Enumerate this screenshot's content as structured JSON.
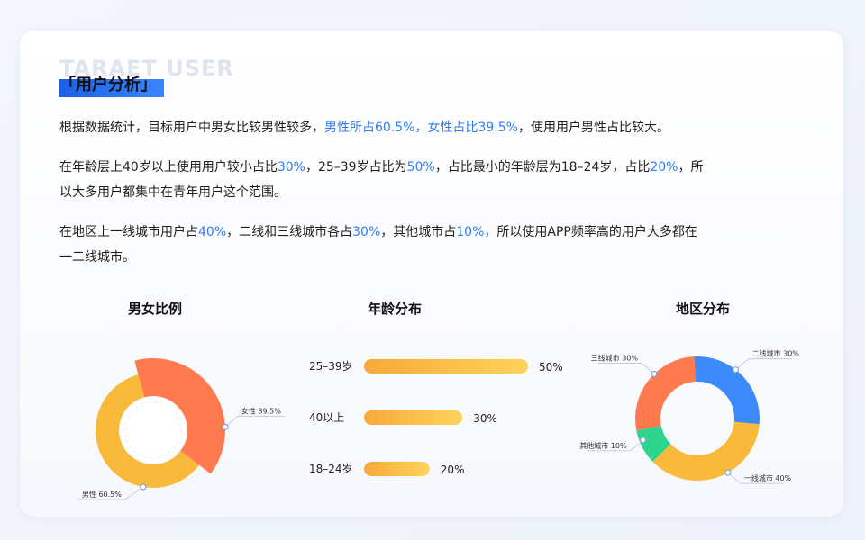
{
  "header": {
    "bg_text": "TARAET USER",
    "title": "「用户分析」"
  },
  "paragraphs": [
    [
      {
        "t": "根据数据统计，目标用户中男女比较男性较多，",
        "hl": false
      },
      {
        "t": "男性所占60.5%，女性占比39.5%",
        "hl": true
      },
      {
        "t": "，使用用户男性占比较大。",
        "hl": false
      }
    ],
    [
      {
        "t": "在年龄层上40岁以上使用用户较小占比",
        "hl": false
      },
      {
        "t": "30%",
        "hl": true
      },
      {
        "t": "，25–39岁占比为",
        "hl": false
      },
      {
        "t": "50%",
        "hl": true
      },
      {
        "t": "，占比最小的年龄层为18–24岁，占比",
        "hl": false
      },
      {
        "t": "20%",
        "hl": true
      },
      {
        "t": "，所以大多用户都集中在青年用户这个范围。",
        "hl": false
      }
    ],
    [
      {
        "t": "在地区上一线城市用户占",
        "hl": false
      },
      {
        "t": "40%",
        "hl": true
      },
      {
        "t": "，二线和三线城市各占",
        "hl": false
      },
      {
        "t": "30%",
        "hl": true
      },
      {
        "t": "，其他城市占",
        "hl": false
      },
      {
        "t": "10%，",
        "hl": true
      },
      {
        "t": "所以使用APP频率高的用户大多都在一二线城市。",
        "hl": false
      }
    ]
  ],
  "chart_data": [
    {
      "type": "pie",
      "title": "男女比例",
      "slices": [
        {
          "name": "男性",
          "value": 60.5,
          "label": "男性  60.5%",
          "color": "#f9b93a"
        },
        {
          "name": "女性",
          "value": 39.5,
          "label": "女性  39.5%",
          "color": "#ff7b4f"
        }
      ]
    },
    {
      "type": "bar",
      "title": "年龄分布",
      "orientation": "horizontal",
      "categories": [
        "25–39岁",
        "40以上",
        "18–24岁"
      ],
      "values": [
        50,
        30,
        20
      ],
      "value_labels": [
        "50%",
        "30%",
        "20%"
      ],
      "color_start": "#f7a93b",
      "color_end": "#ffd35c"
    },
    {
      "type": "pie",
      "title": "地区分布",
      "slices": [
        {
          "name": "二线城市",
          "value": 30,
          "label": "二线城市  30%",
          "color": "#3d8bfa"
        },
        {
          "name": "一线城市",
          "value": 40,
          "label": "一线城市  40%",
          "color": "#f9b93a"
        },
        {
          "name": "其他城市",
          "value": 10,
          "label": "其他城市  10%",
          "color": "#2fd48d"
        },
        {
          "name": "三线城市",
          "value": 30,
          "label": "三线城市  30%",
          "color": "#ff7b4f"
        }
      ]
    }
  ]
}
